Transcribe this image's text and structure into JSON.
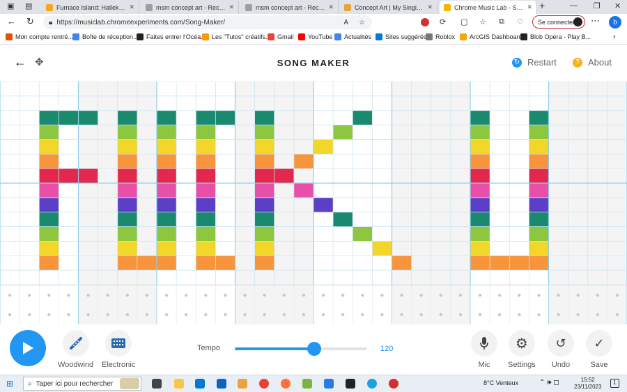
{
  "browser": {
    "tabs": [
      {
        "label": "Furnace Island: Hallekhzendurr...",
        "color": "#f5a623",
        "active": false
      },
      {
        "label": "msm concept art - Recherche",
        "color": "#9aa0a6",
        "active": false
      },
      {
        "label": "msm concept art - Recherche",
        "color": "#9aa0a6",
        "active": false
      },
      {
        "label": "Concept Art | My Singing Monst...",
        "color": "#e6a23c",
        "active": false
      },
      {
        "label": "Chrome Music Lab - Song Mak...",
        "color": "#f4b400",
        "active": true
      }
    ],
    "new_tab": "+",
    "url": "https://musiclab.chromeexperiments.com/Song-Maker/",
    "signin_label": "Se connecter",
    "bookmarks": [
      {
        "label": "Mon compte rentré...",
        "color": "#e65100"
      },
      {
        "label": "Boîte de réception...",
        "color": "#4285f4"
      },
      {
        "label": "Faites entrer l'Océa...",
        "color": "#222222"
      },
      {
        "label": "Les \"Tutos\" créatifs...",
        "color": "#ff9800"
      },
      {
        "label": "Gmail",
        "color": "#ea4335"
      },
      {
        "label": "YouTube",
        "color": "#ff0000"
      },
      {
        "label": "Actualités",
        "color": "#4285f4"
      },
      {
        "label": "Sites suggérés",
        "color": "#0078d4"
      },
      {
        "label": "Roblox",
        "color": "#777777"
      },
      {
        "label": "ArcGIS Dashboards",
        "color": "#f7a800"
      },
      {
        "label": "Blob Opera - Play B...",
        "color": "#222222"
      }
    ]
  },
  "app": {
    "title": "SONG MAKER",
    "restart_label": "Restart",
    "about_label": "About",
    "restart_icon": "restart-icon",
    "about_icon": "question-icon"
  },
  "melody_grid": {
    "columns": 32,
    "rows": 14,
    "row_colors": [
      "#ffffff",
      "#ffffff",
      "#1a8a6e",
      "#8dc63f",
      "#f2d629",
      "#f7943c",
      "#e3274e",
      "#e84fa8",
      "#5b3fc6",
      "#1a8a6e",
      "#8dc63f",
      "#f2d629",
      "#f7943c",
      "#ffffff"
    ],
    "notes": [
      [
        2,
        2
      ],
      [
        2,
        3
      ],
      [
        2,
        4
      ],
      [
        2,
        5
      ],
      [
        2,
        6
      ],
      [
        2,
        7
      ],
      [
        2,
        8
      ],
      [
        2,
        9
      ],
      [
        2,
        10
      ],
      [
        2,
        11
      ],
      [
        2,
        12
      ],
      [
        3,
        2
      ],
      [
        4,
        2
      ],
      [
        3,
        6
      ],
      [
        4,
        6
      ],
      [
        6,
        2
      ],
      [
        6,
        3
      ],
      [
        6,
        4
      ],
      [
        6,
        5
      ],
      [
        6,
        6
      ],
      [
        6,
        7
      ],
      [
        6,
        8
      ],
      [
        6,
        9
      ],
      [
        6,
        10
      ],
      [
        6,
        11
      ],
      [
        6,
        12
      ],
      [
        8,
        2
      ],
      [
        8,
        3
      ],
      [
        8,
        4
      ],
      [
        8,
        5
      ],
      [
        8,
        6
      ],
      [
        8,
        7
      ],
      [
        8,
        8
      ],
      [
        8,
        9
      ],
      [
        8,
        10
      ],
      [
        8,
        11
      ],
      [
        8,
        12
      ],
      [
        7,
        12
      ],
      [
        10,
        2
      ],
      [
        10,
        3
      ],
      [
        10,
        4
      ],
      [
        10,
        5
      ],
      [
        10,
        6
      ],
      [
        10,
        7
      ],
      [
        10,
        8
      ],
      [
        10,
        9
      ],
      [
        10,
        10
      ],
      [
        10,
        11
      ],
      [
        10,
        12
      ],
      [
        11,
        2
      ],
      [
        11,
        12
      ],
      [
        13,
        2
      ],
      [
        13,
        3
      ],
      [
        13,
        4
      ],
      [
        13,
        5
      ],
      [
        13,
        6
      ],
      [
        13,
        7
      ],
      [
        13,
        8
      ],
      [
        13,
        9
      ],
      [
        13,
        10
      ],
      [
        13,
        11
      ],
      [
        13,
        12
      ],
      [
        14,
        6
      ],
      [
        15,
        5
      ],
      [
        16,
        4
      ],
      [
        17,
        3
      ],
      [
        18,
        2
      ],
      [
        15,
        7
      ],
      [
        16,
        8
      ],
      [
        17,
        9
      ],
      [
        18,
        10
      ],
      [
        19,
        11
      ],
      [
        20,
        12
      ],
      [
        24,
        2
      ],
      [
        24,
        3
      ],
      [
        24,
        4
      ],
      [
        24,
        5
      ],
      [
        24,
        6
      ],
      [
        24,
        7
      ],
      [
        24,
        8
      ],
      [
        24,
        9
      ],
      [
        24,
        10
      ],
      [
        24,
        11
      ],
      [
        24,
        12
      ],
      [
        25,
        12
      ],
      [
        27,
        2
      ],
      [
        27,
        3
      ],
      [
        27,
        4
      ],
      [
        27,
        5
      ],
      [
        27,
        6
      ],
      [
        27,
        7
      ],
      [
        27,
        8
      ],
      [
        27,
        9
      ],
      [
        27,
        10
      ],
      [
        27,
        11
      ],
      [
        27,
        12
      ],
      [
        26,
        12
      ]
    ]
  },
  "controls": {
    "play_icon": "play-icon",
    "instrument_label": "Woodwind",
    "instrument_icon": "woodwind-icon",
    "percussion_label": "Electronic",
    "percussion_icon": "electronic-icon",
    "tempo_label": "Tempo",
    "tempo_value": "120",
    "tempo_fraction": 0.6,
    "mic_label": "Mic",
    "settings_label": "Settings",
    "undo_label": "Undo",
    "save_label": "Save",
    "accent_color": "#2196f3"
  },
  "taskbar": {
    "search_placeholder": "Taper ici pour rechercher",
    "weather": "8°C  Venteux",
    "time": "15:52",
    "date": "23/11/2023"
  }
}
